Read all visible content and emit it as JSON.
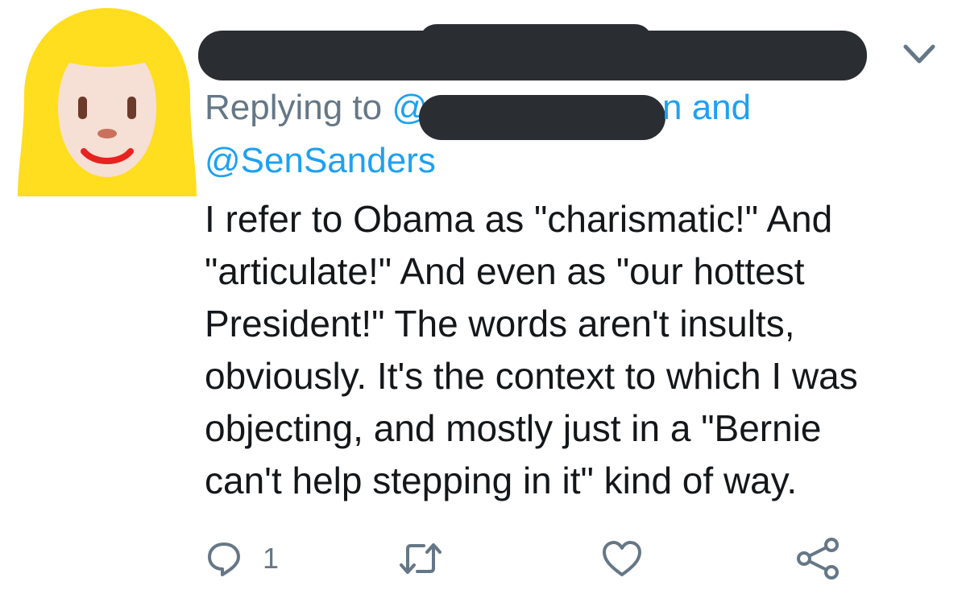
{
  "header": {
    "more_icon": "chevron-down-icon"
  },
  "reply": {
    "prefix": "Replying to ",
    "mention_visible_start": "@",
    "mention_visible_end": "n and",
    "second_mention": "@SenSanders"
  },
  "tweet": {
    "lines": [
      "I refer to Obama as \"charismatic!\" And",
      "\"articulate!\" And even as \"our hottest",
      "President!\" The words aren't insults,",
      "obviously. It's the context to which I was",
      "objecting, and mostly just in a \"Bernie",
      "can't help stepping in it\" kind of way."
    ]
  },
  "actions": {
    "reply_count": "1",
    "icons": [
      "reply-icon",
      "retweet-icon",
      "like-icon",
      "share-icon"
    ]
  },
  "colors": {
    "text": "#14171a",
    "secondary": "#657786",
    "link": "#1da1f2",
    "redaction": "#2a2d31",
    "avatar_hair": "#ffdd1f",
    "avatar_skin": "#f6dfd5"
  }
}
